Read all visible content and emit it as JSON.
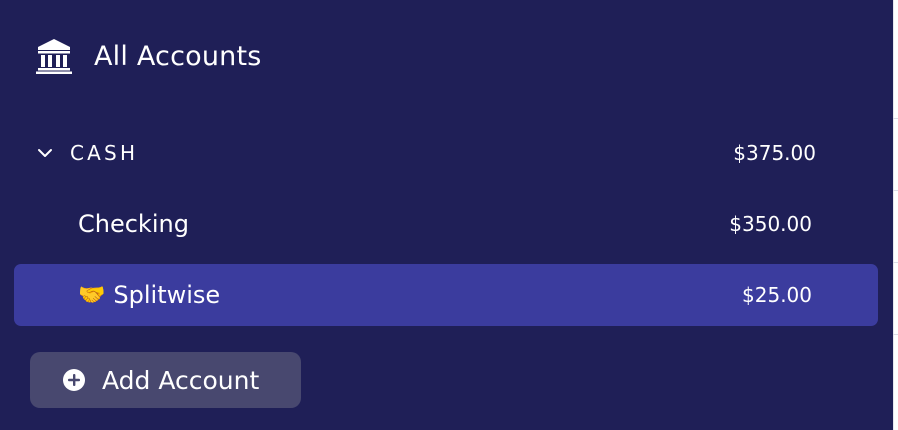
{
  "sidebar": {
    "all_accounts_label": "All Accounts",
    "groups": [
      {
        "label": "CASH",
        "total": "$375.00",
        "expanded": true,
        "accounts": [
          {
            "name": "Checking",
            "balance": "$350.00",
            "selected": false,
            "emoji": ""
          },
          {
            "name": "Splitwise",
            "balance": "$25.00",
            "selected": true,
            "emoji": "🤝"
          }
        ]
      }
    ],
    "add_account_label": "Add Account"
  },
  "icons": {
    "bank": "bank-icon",
    "chevron": "chevron-down-icon",
    "add": "plus-circle-icon"
  },
  "colors": {
    "sidebar_bg": "#1f1f57",
    "selected_row_bg": "#3b3c9e",
    "add_button_bg": "#48486f",
    "text": "#ffffff"
  }
}
